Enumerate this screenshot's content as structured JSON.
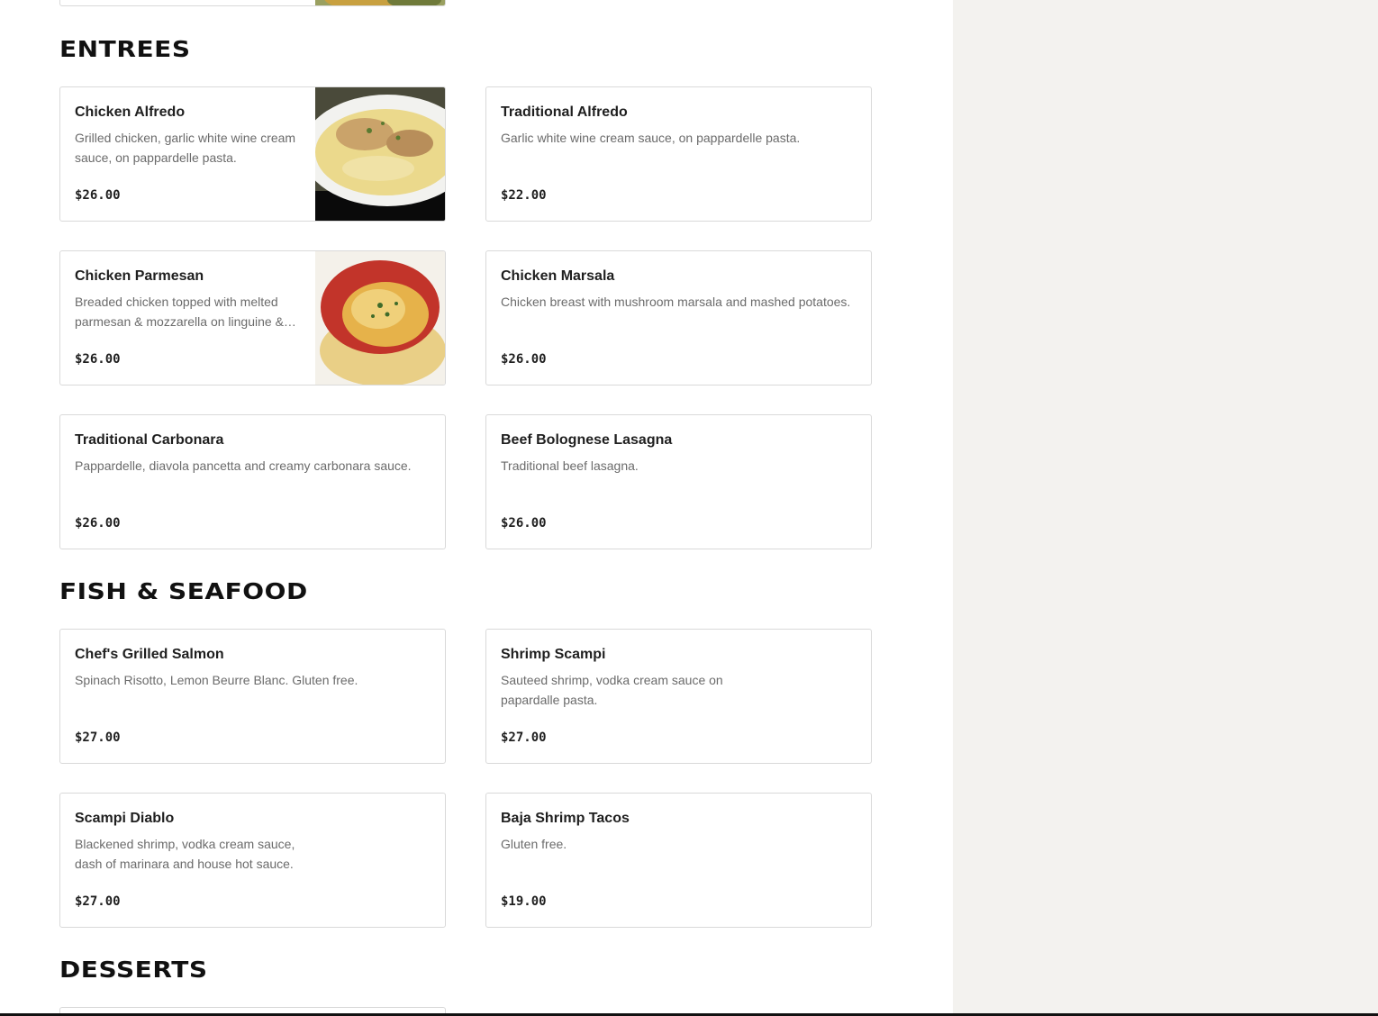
{
  "sections": {
    "entrees": {
      "title": "ENTREES",
      "items": [
        {
          "name": "Chicken Alfredo",
          "desc": "Grilled chicken, garlic white wine cream sauce, on pappardelle pasta.",
          "price": "$26.00"
        },
        {
          "name": "Traditional Alfredo",
          "desc": "Garlic white wine cream sauce, on pappardelle pasta.",
          "price": "$22.00"
        },
        {
          "name": "Chicken Parmesan",
          "desc": "Breaded chicken topped with melted parmesan & mozzarella on linguine & marinara.",
          "price": "$26.00"
        },
        {
          "name": "Chicken Marsala",
          "desc": "Chicken breast with mushroom marsala and mashed potatoes.",
          "price": "$26.00"
        },
        {
          "name": "Traditional Carbonara",
          "desc": "Pappardelle, diavola pancetta and creamy carbonara sauce.",
          "price": "$26.00"
        },
        {
          "name": "Beef Bolognese Lasagna",
          "desc": "Traditional beef lasagna.",
          "price": "$26.00"
        }
      ]
    },
    "seafood": {
      "title": "FISH & SEAFOOD",
      "items": [
        {
          "name": "Chef's Grilled Salmon",
          "desc": "Spinach Risotto, Lemon Beurre Blanc. Gluten free.",
          "price": "$27.00"
        },
        {
          "name": "Shrimp Scampi",
          "desc": "Sauteed shrimp, vodka cream sauce on papardalle pasta.",
          "price": "$27.00"
        },
        {
          "name": "Scampi Diablo",
          "desc": "Blackened shrimp, vodka cream sauce, dash of marinara and house hot sauce.",
          "price": "$27.00"
        },
        {
          "name": "Baja Shrimp Tacos",
          "desc": "Gluten free.",
          "price": "$19.00"
        }
      ]
    },
    "desserts": {
      "title": "DESSERTS"
    }
  },
  "colors": {
    "page_bg": "#ffffff",
    "side_panel_bg": "#f3f2ef",
    "card_border": "#d9d9d9",
    "desc_text": "#6b6b6b",
    "title_text": "#111111"
  }
}
